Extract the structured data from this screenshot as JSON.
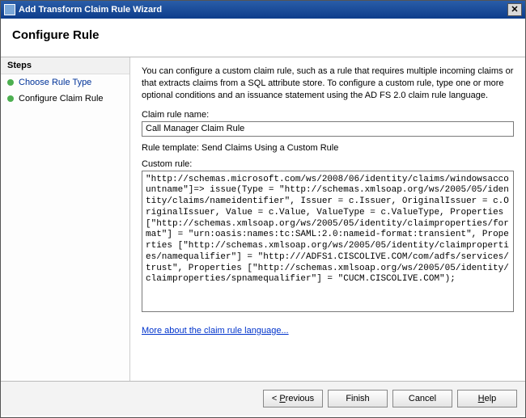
{
  "window": {
    "title": "Add Transform Claim Rule Wizard"
  },
  "header": {
    "title": "Configure Rule"
  },
  "sidebar": {
    "header": "Steps",
    "items": [
      {
        "label": "Choose Rule Type"
      },
      {
        "label": "Configure Claim Rule"
      }
    ]
  },
  "main": {
    "description": "You can configure a custom claim rule, such as a rule that requires multiple incoming claims or that extracts claims from a SQL attribute store. To configure a custom rule, type one or more optional conditions and an issuance statement using the AD FS 2.0 claim rule language.",
    "claim_rule_name_label": "Claim rule name:",
    "claim_rule_name_value": "Call Manager Claim Rule",
    "rule_template_label": "Rule template: Send Claims Using a Custom Rule",
    "custom_rule_label": "Custom rule:",
    "custom_rule_value": "\"http://schemas.microsoft.com/ws/2008/06/identity/claims/windowsaccountname\"]=> issue(Type = \"http://schemas.xmlsoap.org/ws/2005/05/identity/claims/nameidentifier\", Issuer = c.Issuer, OriginalIssuer = c.OriginalIssuer, Value = c.Value, ValueType = c.ValueType, Properties [\"http://schemas.xmlsoap.org/ws/2005/05/identity/claimproperties/format\"] = \"urn:oasis:names:tc:SAML:2.0:nameid-format:transient\", Properties [\"http://schemas.xmlsoap.org/ws/2005/05/identity/claimproperties/namequalifier\"] = \"http:///ADFS1.CISCOLIVE.COM/com/adfs/services/trust\", Properties [\"http://schemas.xmlsoap.org/ws/2005/05/identity/claimproperties/spnamequalifier\"] = \"CUCM.CISCOLIVE.COM\");",
    "link_label": "More about the claim rule language..."
  },
  "footer": {
    "previous": "< Previous",
    "finish": "Finish",
    "cancel": "Cancel",
    "help": "Help"
  }
}
